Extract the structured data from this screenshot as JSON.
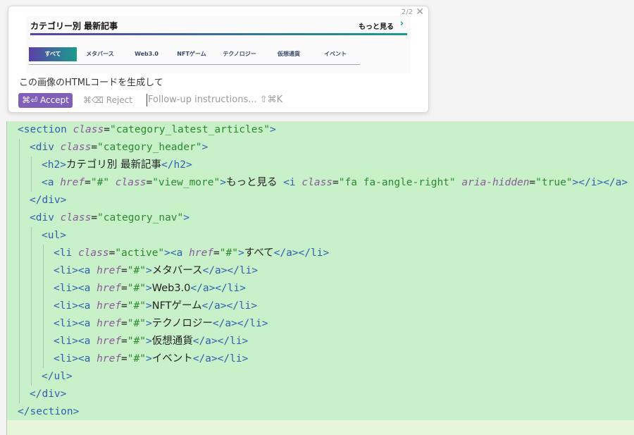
{
  "popup": {
    "counter": "2/2",
    "close_icon": "close-icon",
    "thumbnail": {
      "title": "カテゴリー別 最新記事",
      "more": "もっと見る",
      "tabs": [
        "すべて",
        "メタバース",
        "Web3.0",
        "NFTゲーム",
        "テクノロジー",
        "仮想通貨",
        "イベント"
      ]
    },
    "prompt": "この画像のHTMLコードを生成して",
    "accept_label": "⌘⏎ Accept",
    "reject_label": "⌘⌫ Reject",
    "followup_placeholder": "Follow-up instructions... ⇧⌘K"
  },
  "code": {
    "h2": "カテゴリ別 最新記事",
    "view_more": "もっと見る",
    "nav": [
      "すべて",
      "メタバース",
      "Web3.0",
      "NFTゲーム",
      "テクノロジー",
      "仮想通貨",
      "イベント"
    ]
  },
  "colors": {
    "diff_added": "#c8f0c9",
    "accept_button": "#7f5fb8",
    "tag": "#2f5fb0",
    "string": "#2b8a2f"
  }
}
